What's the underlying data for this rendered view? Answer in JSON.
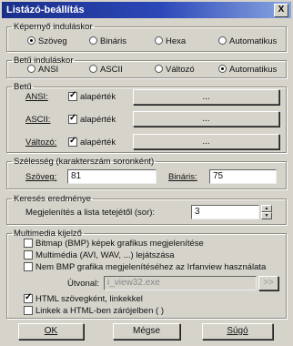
{
  "window": {
    "title": "Listázó-beállítás",
    "close_label": "X"
  },
  "startup_screen": {
    "legend": "Képernyő induláskor",
    "options": [
      "Szöveg",
      "Bináris",
      "Hexa",
      "Automatikus"
    ],
    "selected": "Szöveg"
  },
  "startup_font": {
    "legend": "Betű induláskor",
    "options": [
      "ANSI",
      "ASCII",
      "Változó",
      "Automatikus"
    ],
    "selected": "Automatikus"
  },
  "font": {
    "legend": "Betű",
    "rows": [
      {
        "label": "ANSI:",
        "check_label": "alapérték",
        "checked": true,
        "button": "..."
      },
      {
        "label": "ASCII:",
        "check_label": "alapérték",
        "checked": true,
        "button": "..."
      },
      {
        "label": "Változó:",
        "check_label": "alapérték",
        "checked": true,
        "button": "..."
      }
    ]
  },
  "width": {
    "legend": "Szélesség (karakterszám soronként)",
    "text_label": "Szöveg:",
    "text_value": "81",
    "binary_label": "Bináris:",
    "binary_value": "75"
  },
  "search": {
    "legend": "Keresés eredménye",
    "label": "Megjelenítés a lista tetejétől (sor):",
    "value": "3"
  },
  "multimedia": {
    "legend": "Multimedia kijelző",
    "options": [
      {
        "label": "Bitmap (BMP) képek grafikus megjelenítése",
        "checked": false
      },
      {
        "label": "Multimédia (AVI, WAV, ...) lejátszása",
        "checked": false
      },
      {
        "label": "Nem BMP grafika megjelenítéséhez az Irfanview használata",
        "checked": false
      }
    ],
    "path_label": "Útvonal:",
    "path_value": "i_view32.exe",
    "browse": ">>",
    "html_text": {
      "label": "HTML szövegként, linkekkel",
      "checked": true
    },
    "links_bracket": {
      "label": "Linkek a HTML-ben zárójelben ( )",
      "checked": false
    }
  },
  "buttons": {
    "ok": "OK",
    "cancel": "Mégse",
    "help": "Súgó"
  }
}
